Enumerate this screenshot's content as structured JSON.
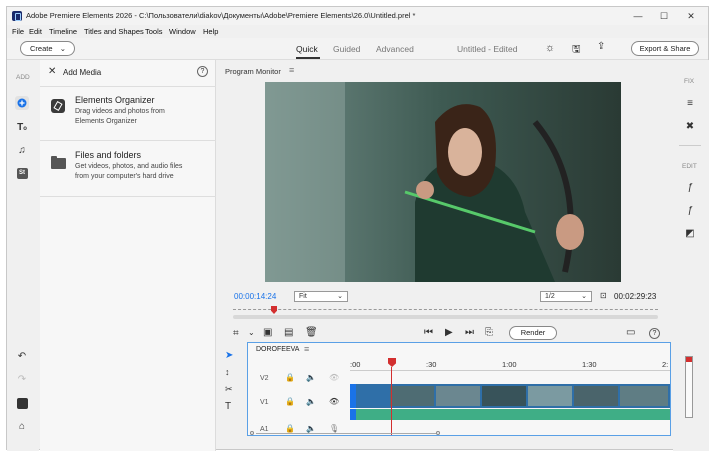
{
  "window": {
    "title": "Adobe Premiere Elements 2026 - C:\\Пользователи\\diakov\\Документы\\Adobe\\Premiere Elements\\26.0\\Untitled.prel *",
    "minimize": "—",
    "maximize": "☐",
    "close": "✕"
  },
  "menu": [
    "File",
    "Edit",
    "Timeline",
    "Titles and Shapes",
    "Tools",
    "Window",
    "Help"
  ],
  "toolbar": {
    "create_label": "Create",
    "modes": [
      "Quick",
      "Guided",
      "Advanced"
    ],
    "active_mode": "Quick",
    "project_status": "Untitled - Edited",
    "export_label": "Export & Share"
  },
  "left_rail": {
    "add_label": "ADD"
  },
  "add_media": {
    "title": "Add Media",
    "help": "?",
    "items": [
      {
        "title": "Elements Organizer",
        "desc1": "Drag videos and photos from",
        "desc2": "Elements Organizer"
      },
      {
        "title": "Files and folders",
        "desc1": "Get videos, photos, and audio files",
        "desc2": "from your computer's hard drive"
      }
    ]
  },
  "monitor": {
    "title": "Program Monitor",
    "current_time": "00:00:14:24",
    "fit_option": "Fit",
    "resolution": "1/2",
    "duration": "00:02:29:23",
    "render_label": "Render"
  },
  "timeline": {
    "sequence_name": "DOROFEEVA",
    "ruler": [
      ":00",
      ":30",
      "1:00",
      "1:30",
      "2:"
    ],
    "tracks": [
      "V2",
      "V1",
      "A1"
    ]
  },
  "right_rail": {
    "fix_label": "FIX",
    "edit_label": "EDIT"
  },
  "colors": {
    "accent": "#1a73e8",
    "playhead": "#d32f2f",
    "audio_track": "#3fae86",
    "video_clip": "#2f6fa8"
  }
}
